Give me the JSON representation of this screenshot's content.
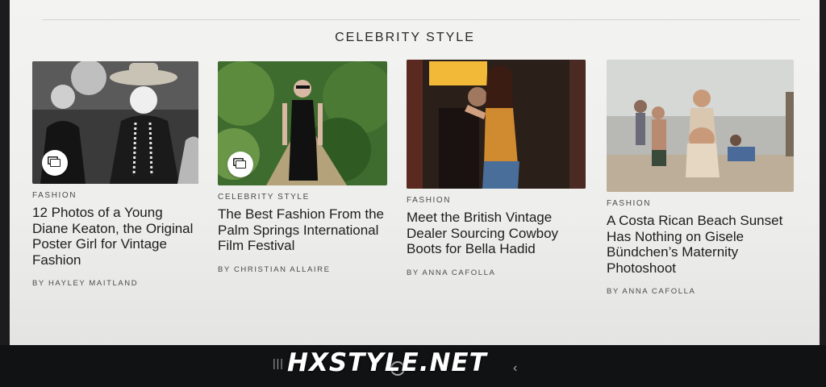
{
  "section": {
    "title": "CELEBRITY STYLE"
  },
  "cards": [
    {
      "category": "FASHION",
      "headline": "12 Photos of a Young Diane Keaton, the Original Poster Girl for Vintage Fashion",
      "byline": "BY HAYLEY MAITLAND",
      "gallery_icon": "gallery-icon"
    },
    {
      "category": "CELEBRITY STYLE",
      "headline": "The Best Fashion From the Palm Springs International Film Festival",
      "byline": "BY CHRISTIAN ALLAIRE",
      "gallery_icon": "gallery-icon"
    },
    {
      "category": "FASHION",
      "headline": "Meet the British Vintage Dealer Sourcing Cowboy Boots for Bella Hadid",
      "byline": "BY ANNA CAFOLLA"
    },
    {
      "category": "FASHION",
      "headline": "A Costa Rican Beach Sunset Has Nothing on Gisele Bündchen’s Maternity Photoshoot",
      "byline": "BY ANNA CAFOLLA"
    }
  ],
  "system_nav": {
    "recent": "|||",
    "back": "‹"
  },
  "watermark": "HXSTYLE.NET"
}
